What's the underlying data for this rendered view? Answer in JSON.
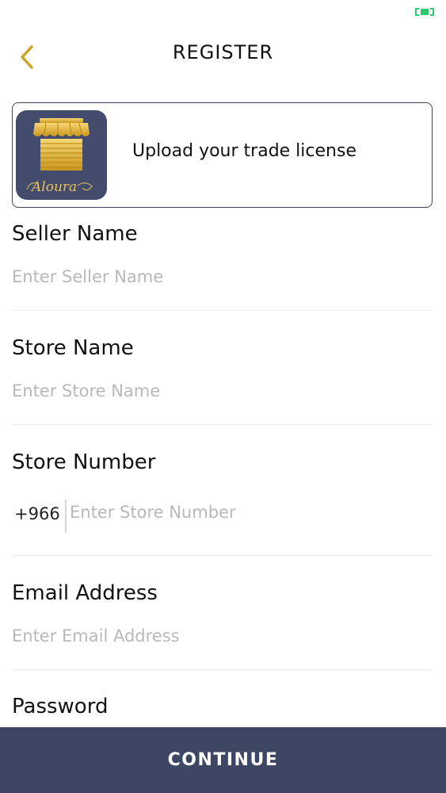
{
  "header": {
    "title": "REGISTER",
    "back_icon": "chevron-left-icon",
    "accent_color": "#c9a227"
  },
  "status_bar": {
    "icon": "battery-icon",
    "color": "#2ecc71"
  },
  "upload": {
    "label": "Upload your trade license",
    "logo_text": "Aloura",
    "logo_icon": "store-awning-logo"
  },
  "form": {
    "seller_name": {
      "label": "Seller Name",
      "placeholder": "Enter Seller Name"
    },
    "store_name": {
      "label": "Store Name",
      "placeholder": "Enter Store Name"
    },
    "store_number": {
      "label": "Store Number",
      "prefix": "+966",
      "placeholder": "Enter Store Number"
    },
    "email": {
      "label": "Email Address",
      "placeholder": "Enter Email Address"
    },
    "password": {
      "label": "Password"
    }
  },
  "footer": {
    "continue_label": "CONTINUE",
    "button_color": "#3d4663"
  }
}
